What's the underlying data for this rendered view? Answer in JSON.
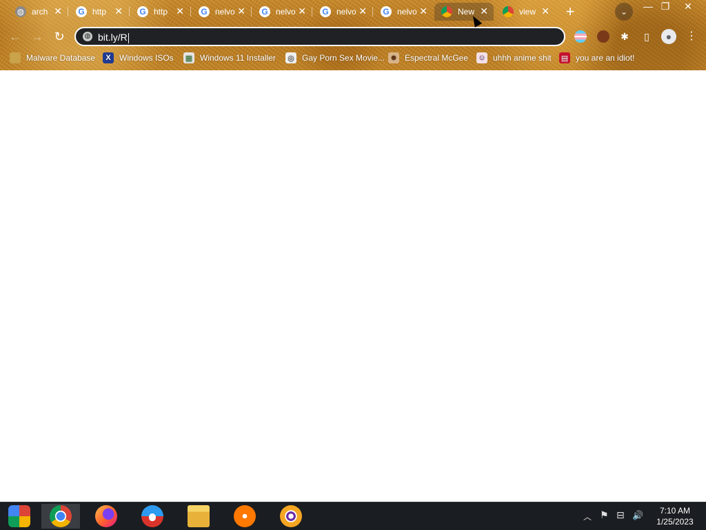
{
  "browser": {
    "tabs": [
      {
        "title": "arch",
        "favicon": "world-icon"
      },
      {
        "title": "http",
        "favicon": "google-icon"
      },
      {
        "title": "http",
        "favicon": "google-icon"
      },
      {
        "title": "nelvo",
        "favicon": "google-icon"
      },
      {
        "title": "nelvo",
        "favicon": "google-icon"
      },
      {
        "title": "nelvo",
        "favicon": "google-icon"
      },
      {
        "title": "nelvo",
        "favicon": "google-icon"
      },
      {
        "title": "New",
        "favicon": "chrome-icon",
        "active": true
      },
      {
        "title": "view",
        "favicon": "chrome-icon"
      }
    ],
    "close_glyph": "✕",
    "new_tab_glyph": "+",
    "tab_search_glyph": "⌄",
    "window_controls": {
      "minimize": "—",
      "restore": "❐",
      "close": "✕"
    },
    "toolbar": {
      "back_glyph": "←",
      "forward_glyph": "→",
      "reload_glyph": "↻",
      "address": "bit.ly/R",
      "site_icon_glyph": "◍",
      "puzzle_glyph": "✱",
      "sidepanel_glyph": "▯",
      "profile_glyph": "●",
      "menu_glyph": "⋮"
    },
    "bookmarks": [
      {
        "label": "Malware Database",
        "icon": "folder-icon",
        "glyph": ""
      },
      {
        "label": "Windows ISOs",
        "icon": "x-logo-icon",
        "glyph": "X"
      },
      {
        "label": "Windows 11 Installer",
        "icon": "image-icon",
        "glyph": "▦"
      },
      {
        "label": "Gay Porn Sex Movie...",
        "icon": "disc-icon",
        "glyph": "◎"
      },
      {
        "label": "Espectral McGee",
        "icon": "character-icon",
        "glyph": "☻"
      },
      {
        "label": "uhhh anime shit",
        "icon": "anime-icon",
        "glyph": "☺"
      },
      {
        "label": "you are an idiot!",
        "icon": "flag-icon",
        "glyph": "▤"
      }
    ]
  },
  "taskbar": {
    "apps": [
      {
        "name": "start-button",
        "icon": "chromium-os-icon"
      },
      {
        "name": "chrome",
        "icon": "chrome-icon",
        "active": true
      },
      {
        "name": "firefox",
        "icon": "firefox-icon"
      },
      {
        "name": "internet-explorer",
        "icon": "opera-ie-icon"
      },
      {
        "name": "file-explorer",
        "icon": "folder-icon"
      },
      {
        "name": "avast",
        "icon": "avast-icon"
      },
      {
        "name": "tor",
        "icon": "tor-icon"
      }
    ],
    "tray": {
      "chevron_glyph": "︿",
      "flag_glyph": "⚑",
      "network_glyph": "⊟",
      "volume_glyph": "🔊"
    },
    "time": "7:10 AM",
    "date": "1/25/2023"
  },
  "colors": {
    "chrome_theme": "#bf8326",
    "omnibox_bg": "#202124",
    "taskbar_bg": "#1a1d21",
    "content_bg": "#ffffff"
  }
}
